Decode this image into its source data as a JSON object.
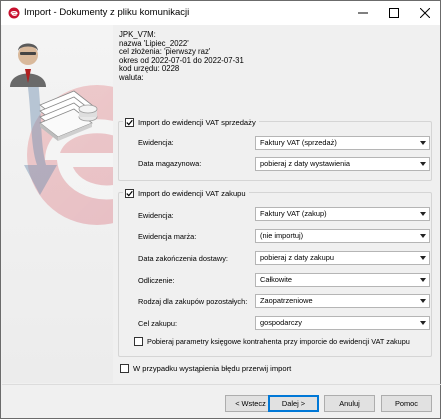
{
  "window": {
    "title": "Import - Dokumenty z pliku komunikacji"
  },
  "info": {
    "line1": "JPK_V7M:",
    "line2": "nazwa 'Lipiec_2022'",
    "line3": "cel złożenia: 'pierwszy raz'",
    "line4": "okres od 2022-07-01 do 2022-07-31",
    "line5": "kod urzędu: 0228",
    "line6": "waluta:"
  },
  "sales_group": {
    "checkbox_label": "Import do ewidencji VAT sprzedaży",
    "checked": true,
    "rows": [
      {
        "label": "Ewidencja:",
        "value": "Faktury VAT (sprzedaż)"
      },
      {
        "label": "Data magazynowa:",
        "value": "pobieraj z daty wystawienia"
      }
    ]
  },
  "purchase_group": {
    "checkbox_label": "Import do ewidencji VAT zakupu",
    "checked": true,
    "rows": [
      {
        "label": "Ewidencja:",
        "value": "Faktury VAT (zakup)"
      },
      {
        "label": "Ewidencja marża:",
        "value": "(nie importuj)"
      },
      {
        "label": "Data zakończenia dostawy:",
        "value": "pobieraj z daty zakupu"
      },
      {
        "label": "Odliczenie:",
        "value": "Całkowite"
      },
      {
        "label": "Rodzaj dla zakupów pozostałych:",
        "value": "Zaopatrzeniowe"
      },
      {
        "label": "Cel zakupu:",
        "value": "gospodarczy"
      }
    ],
    "extra_checkbox_label": "Pobieraj parametry księgowe kontrahenta przy imporcie do ewidencji VAT zakupu",
    "extra_checked": false
  },
  "abort_checkbox": {
    "label": "W przypadku wystąpienia błędu przerwij import",
    "checked": false
  },
  "buttons": {
    "back": "< Wstecz",
    "next": "Dalej >",
    "cancel": "Anuluj",
    "help": "Pomoc"
  },
  "icons": {
    "app": "app-logo-icon",
    "minimize": "minimize-icon",
    "maximize": "maximize-icon",
    "close": "close-icon"
  },
  "colors": {
    "accent": "#0078d7",
    "logo_red": "#c8102e"
  }
}
